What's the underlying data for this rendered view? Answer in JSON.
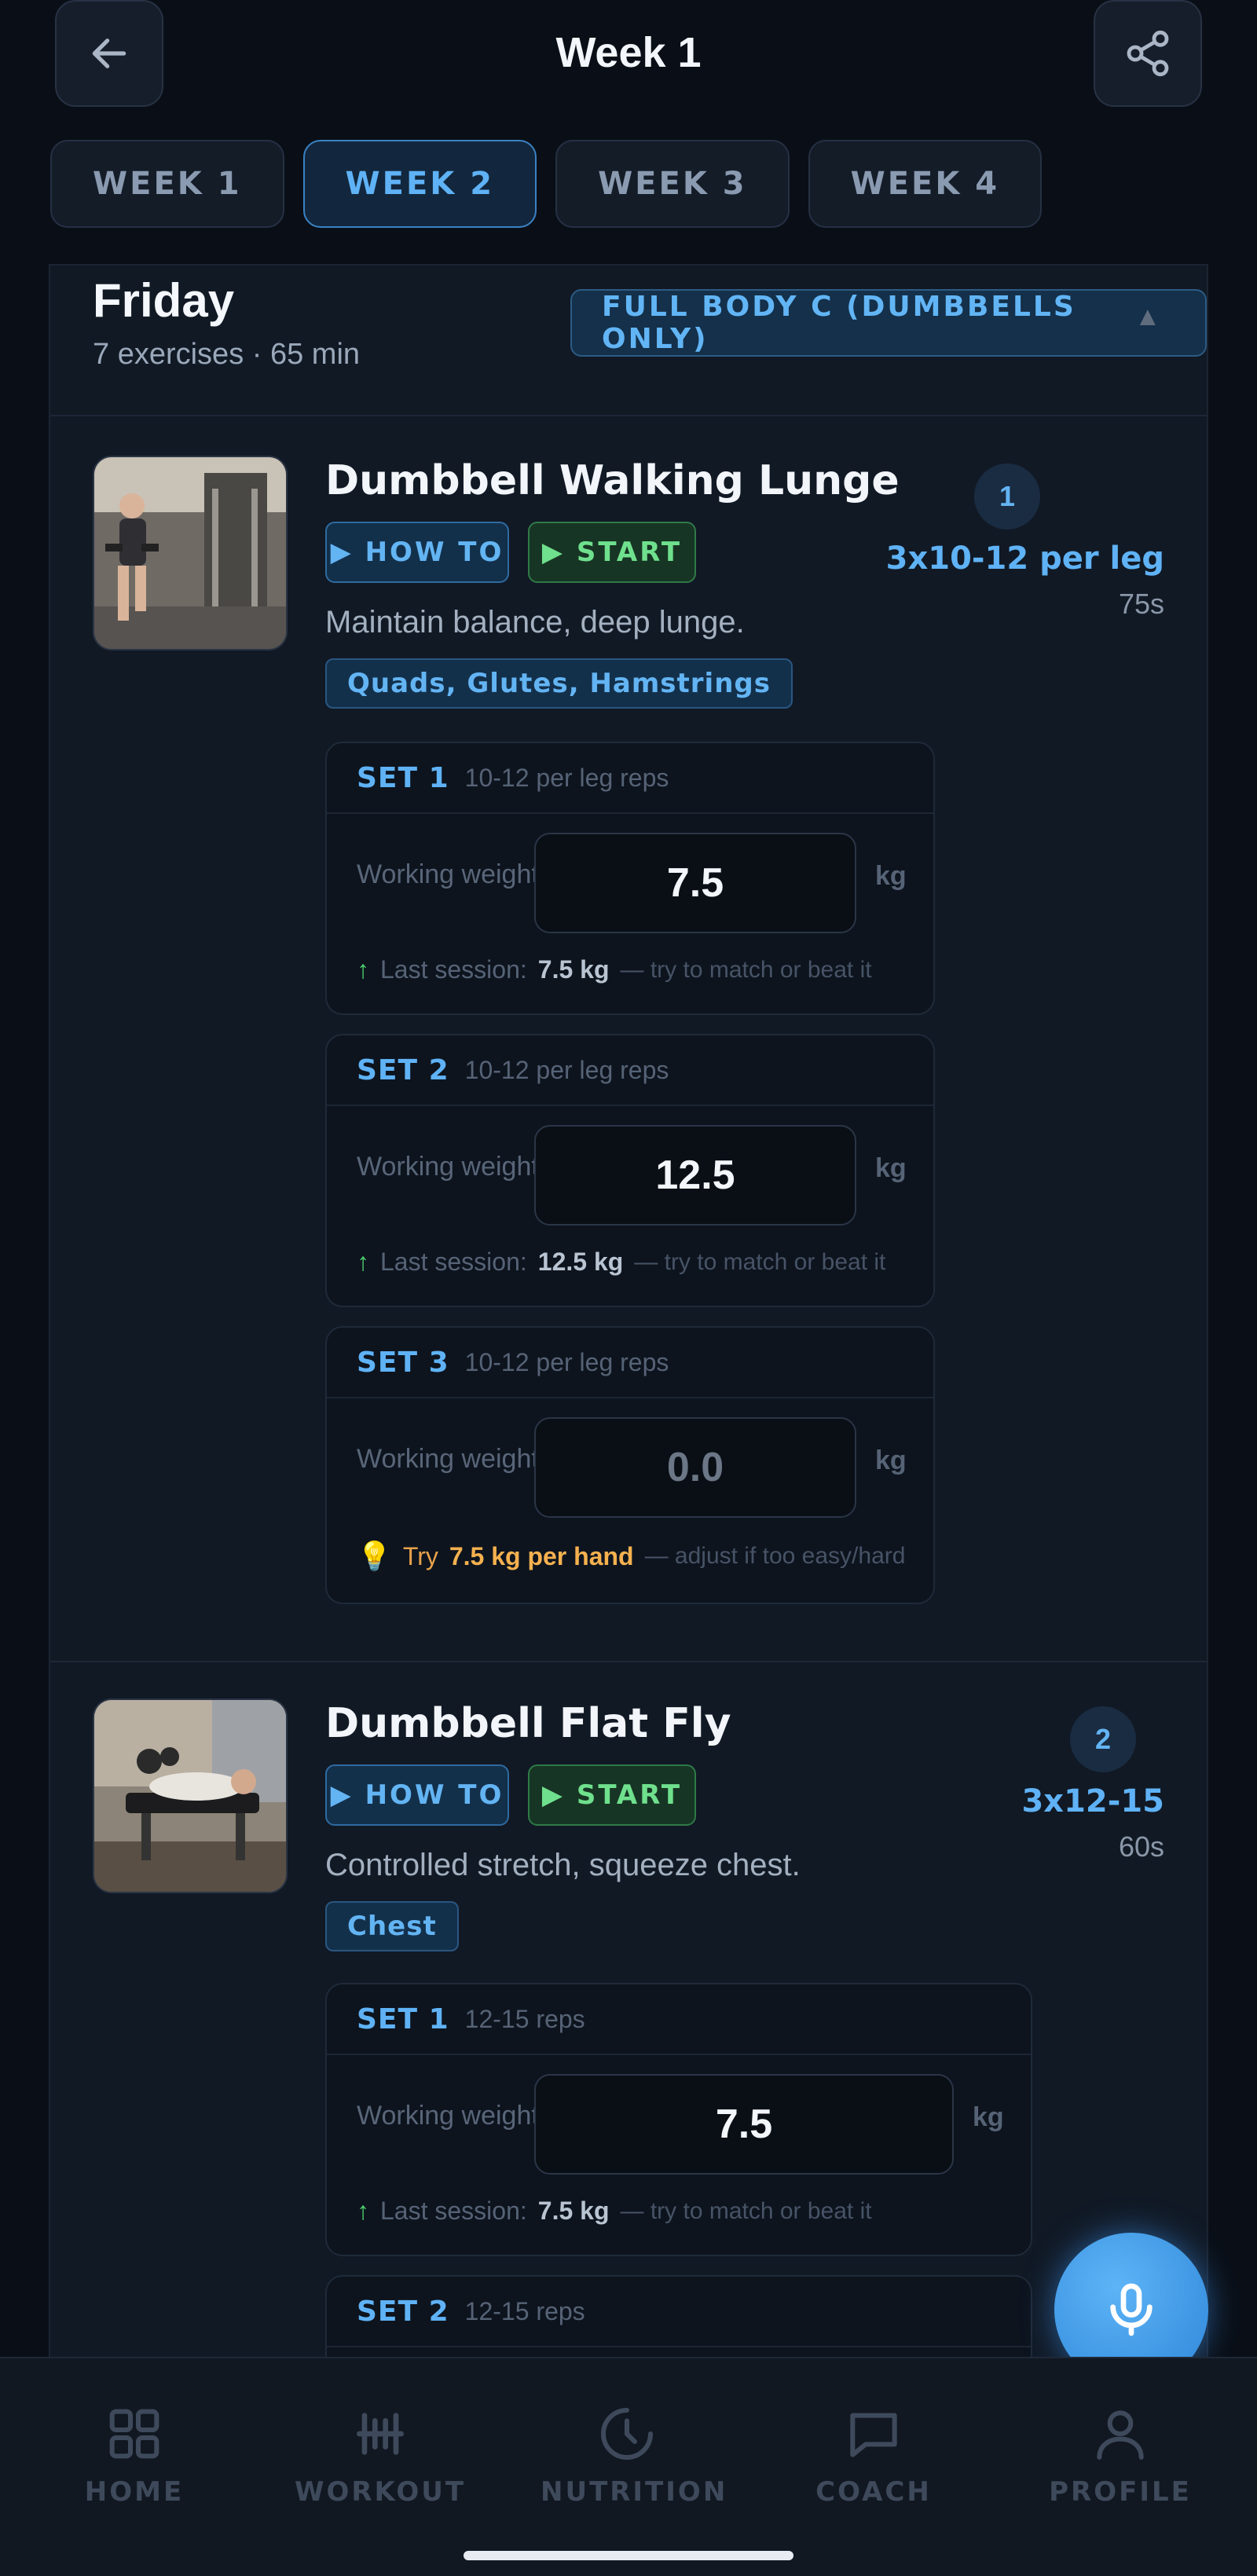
{
  "header": {
    "title": "Week 1"
  },
  "weeks": [
    {
      "label": "WEEK 1",
      "active": false
    },
    {
      "label": "WEEK 2",
      "active": true
    },
    {
      "label": "WEEK 3",
      "active": false
    },
    {
      "label": "WEEK 4",
      "active": false
    }
  ],
  "day": {
    "title": "Friday",
    "subtitle": "7 exercises · 65 min",
    "program": "FULL BODY C (DUMBBELLS ONLY)"
  },
  "exercises": [
    {
      "number": "1",
      "name": "Dumbbell Walking Lunge",
      "howto_label": "▶ HOW TO",
      "start_label": "▶ START",
      "description": "Maintain balance, deep lunge.",
      "muscles": "Quads, Glutes, Hamstrings",
      "scheme": "3x10-12 per leg",
      "rest": "75s",
      "sets": [
        {
          "label": "SET 1",
          "reps": "10-12 per leg reps",
          "ww_label": "Working weight",
          "weight": "7.5",
          "unit": "kg",
          "last_label": "Last session:",
          "last_value": "7.5 kg",
          "hint": "— try to match or beat it"
        },
        {
          "label": "SET 2",
          "reps": "10-12 per leg reps",
          "ww_label": "Working weight",
          "weight": "12.5",
          "unit": "kg",
          "last_label": "Last session:",
          "last_value": "12.5 kg",
          "hint": "— try to match or beat it"
        },
        {
          "label": "SET 3",
          "reps": "10-12 per leg reps",
          "ww_label": "Working weight",
          "weight": "0.0",
          "unit": "kg",
          "tip_prefix": "Try",
          "tip_value": "7.5 kg per hand",
          "hint": "— adjust if too easy/hard"
        }
      ]
    },
    {
      "number": "2",
      "name": "Dumbbell Flat Fly",
      "howto_label": "▶ HOW TO",
      "start_label": "▶ START",
      "description": "Controlled stretch, squeeze chest.",
      "muscles": "Chest",
      "scheme": "3x12-15",
      "rest": "60s",
      "sets": [
        {
          "label": "SET 1",
          "reps": "12-15 reps",
          "ww_label": "Working weight",
          "weight": "7.5",
          "unit": "kg",
          "last_label": "Last session:",
          "last_value": "7.5 kg",
          "hint": "— try to match or beat it"
        },
        {
          "label": "SET 2",
          "reps": "12-15 reps"
        }
      ]
    }
  ],
  "nav": [
    {
      "label": "HOME",
      "icon": "grid-icon"
    },
    {
      "label": "WORKOUT",
      "icon": "barbell-icon"
    },
    {
      "label": "NUTRITION",
      "icon": "clock-icon"
    },
    {
      "label": "COACH",
      "icon": "chat-icon"
    },
    {
      "label": "PROFILE",
      "icon": "user-icon"
    }
  ],
  "colors": {
    "accent": "#5fb2f5",
    "success": "#6fe08d",
    "warning": "#f5b14f",
    "background": "#0a0f17"
  }
}
